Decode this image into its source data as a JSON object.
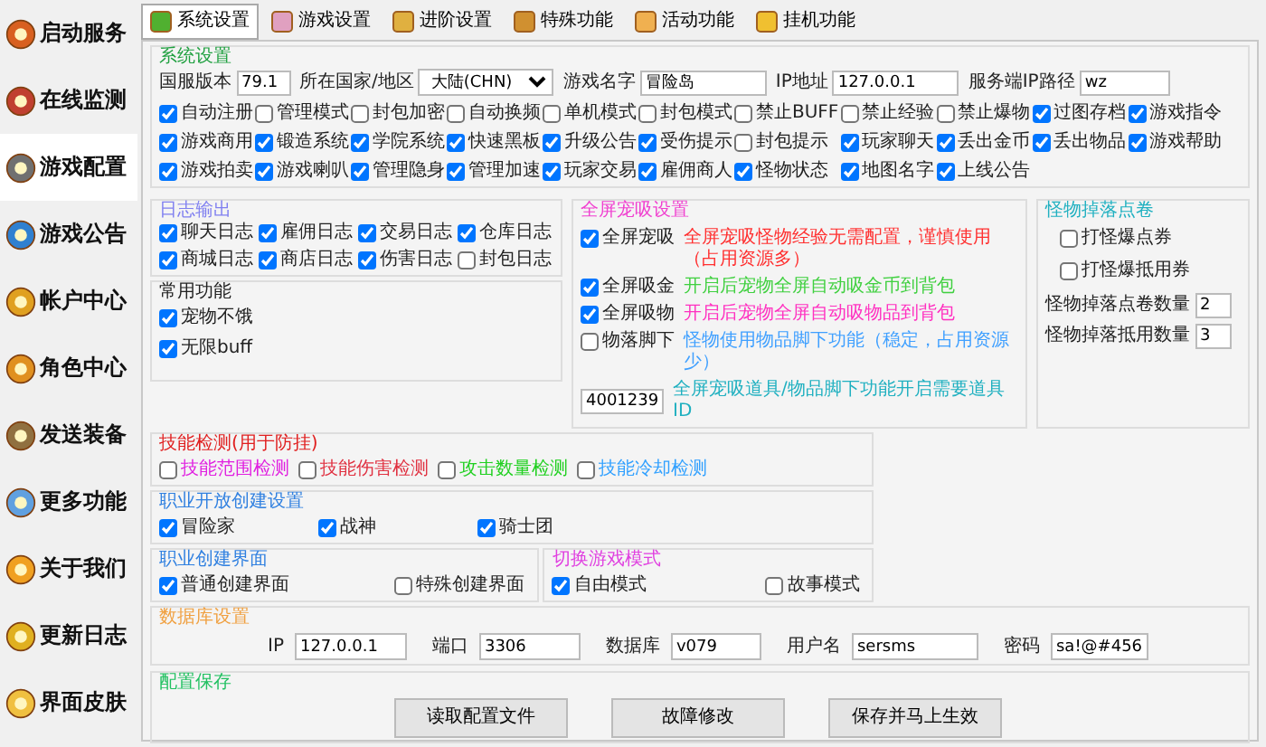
{
  "sidebar": {
    "items": [
      {
        "label": "启动服务",
        "selected": false
      },
      {
        "label": "在线监测",
        "selected": false
      },
      {
        "label": "游戏配置",
        "selected": true
      },
      {
        "label": "游戏公告",
        "selected": false
      },
      {
        "label": "帐户中心",
        "selected": false
      },
      {
        "label": "角色中心",
        "selected": false
      },
      {
        "label": "发送装备",
        "selected": false
      },
      {
        "label": "更多功能",
        "selected": false
      },
      {
        "label": "关于我们",
        "selected": false
      },
      {
        "label": "更新日志",
        "selected": false
      },
      {
        "label": "界面皮肤",
        "selected": false
      }
    ]
  },
  "tabs": [
    {
      "label": "系统设置",
      "selected": true
    },
    {
      "label": "游戏设置",
      "selected": false
    },
    {
      "label": "进阶设置",
      "selected": false
    },
    {
      "label": "特殊功能",
      "selected": false
    },
    {
      "label": "活动功能",
      "selected": false
    },
    {
      "label": "挂机功能",
      "selected": false
    }
  ],
  "system_settings": {
    "title": "系统设置",
    "fields": [
      {
        "label": "国服版本",
        "value": "79.1",
        "kind": "text"
      },
      {
        "label": "所在国家/地区",
        "value": "大陆(CHN)",
        "kind": "select"
      },
      {
        "label": "游戏名字",
        "value": "冒险岛",
        "kind": "text"
      },
      {
        "label": "IP地址",
        "value": "127.0.0.1",
        "kind": "text"
      },
      {
        "label": "服务端IP路径",
        "value": "wz",
        "kind": "text"
      }
    ],
    "checkbox_rows": [
      [
        {
          "label": "自动注册",
          "checked": true
        },
        {
          "label": "管理模式",
          "checked": false
        },
        {
          "label": "封包加密",
          "checked": false
        },
        {
          "label": "自动换频",
          "checked": false
        },
        {
          "label": "单机模式",
          "checked": false
        },
        {
          "label": "封包模式",
          "checked": false
        },
        {
          "label": "禁止BUFF",
          "checked": false
        },
        {
          "label": "禁止经验",
          "checked": false
        },
        {
          "label": "禁止爆物",
          "checked": false
        },
        {
          "label": "过图存档",
          "checked": true
        },
        {
          "label": "游戏指令",
          "checked": true
        }
      ],
      [
        {
          "label": "游戏商用",
          "checked": true
        },
        {
          "label": "锻造系统",
          "checked": true
        },
        {
          "label": "学院系统",
          "checked": true
        },
        {
          "label": "快速黑板",
          "checked": true
        },
        {
          "label": "升级公告",
          "checked": true
        },
        {
          "label": "受伤提示",
          "checked": true
        },
        {
          "label": "封包提示",
          "checked": false
        },
        {
          "label": "玩家聊天",
          "checked": true
        },
        {
          "label": "丢出金币",
          "checked": true
        },
        {
          "label": "丢出物品",
          "checked": true
        },
        {
          "label": "游戏帮助",
          "checked": true
        }
      ],
      [
        {
          "label": "游戏拍卖",
          "checked": true
        },
        {
          "label": "游戏喇叭",
          "checked": true
        },
        {
          "label": "管理隐身",
          "checked": true
        },
        {
          "label": "管理加速",
          "checked": true
        },
        {
          "label": "玩家交易",
          "checked": true
        },
        {
          "label": "雇佣商人",
          "checked": true
        },
        {
          "label": "怪物状态",
          "checked": true
        },
        {
          "label": "地图名字",
          "checked": true
        },
        {
          "label": "上线公告",
          "checked": true
        }
      ]
    ]
  },
  "log_output": {
    "title": "日志输出",
    "checkboxes": [
      {
        "label": "聊天日志",
        "checked": true
      },
      {
        "label": "雇佣日志",
        "checked": true
      },
      {
        "label": "交易日志",
        "checked": true
      },
      {
        "label": "仓库日志",
        "checked": true
      },
      {
        "label": "商城日志",
        "checked": true
      },
      {
        "label": "商店日志",
        "checked": true
      },
      {
        "label": "伤害日志",
        "checked": true
      },
      {
        "label": "封包日志",
        "checked": false
      }
    ]
  },
  "common_functions": {
    "title": "常用功能",
    "checkboxes": [
      {
        "label": "宠物不饿",
        "checked": true
      },
      {
        "label": "无限buff",
        "checked": true
      }
    ]
  },
  "pet_vacuum": {
    "title": "全屏宠吸设置",
    "options": [
      {
        "label": "全屏宠吸",
        "checked": true,
        "note": "全屏宠吸怪物经验无需配置，谨慎使用（占用资源多）",
        "color": "#ff3030"
      },
      {
        "label": "全屏吸金",
        "checked": true,
        "note": "开启后宠物全屏自动吸金币到背包",
        "color": "#40d040"
      },
      {
        "label": "全屏吸物",
        "checked": true,
        "note": "开启后宠物全屏自动吸物品到背包",
        "color": "#ff30c0"
      },
      {
        "label": "物落脚下",
        "checked": false,
        "note": "怪物使用物品脚下功能（稳定，占用资源少）",
        "color": "#40a0ff"
      }
    ],
    "id_field": {
      "value": "4001239",
      "note": "全屏宠吸道具/物品脚下功能开启需要道具ID"
    }
  },
  "monster_drop": {
    "title": "怪物掉落点卷",
    "checkboxes": [
      {
        "label": "打怪爆点券",
        "checked": false
      },
      {
        "label": "打怪爆抵用券",
        "checked": false
      }
    ],
    "fields": [
      {
        "label": "怪物掉落点卷数量",
        "value": "2"
      },
      {
        "label": "怪物掉落抵用数量",
        "value": "3"
      }
    ]
  },
  "skill_check": {
    "title": "技能检测(用于防挂)",
    "checkboxes": [
      {
        "label": "技能范围检测",
        "checked": false,
        "color": "#e020e0"
      },
      {
        "label": "技能伤害检测",
        "checked": false,
        "color": "#e03040"
      },
      {
        "label": "攻击数量检测",
        "checked": false,
        "color": "#20d020"
      },
      {
        "label": "技能冷却检测",
        "checked": false,
        "color": "#30a0ff"
      }
    ]
  },
  "job_open": {
    "title": "职业开放创建设置",
    "checkboxes": [
      {
        "label": "冒险家",
        "checked": true
      },
      {
        "label": "战神",
        "checked": true
      },
      {
        "label": "骑士团",
        "checked": true
      }
    ]
  },
  "create_ui": {
    "title": "职业创建界面",
    "checkboxes": [
      {
        "label": "普通创建界面",
        "checked": true
      },
      {
        "label": "特殊创建界面",
        "checked": false
      }
    ]
  },
  "game_mode": {
    "title": "切换游戏模式",
    "checkboxes": [
      {
        "label": "自由模式",
        "checked": true
      },
      {
        "label": "故事模式",
        "checked": false
      }
    ]
  },
  "database": {
    "title": "数据库设置",
    "fields": [
      {
        "label": "IP",
        "value": "127.0.0.1"
      },
      {
        "label": "端口",
        "value": "3306"
      },
      {
        "label": "数据库",
        "value": "v079"
      },
      {
        "label": "用户名",
        "value": "sersms"
      },
      {
        "label": "密码",
        "value": "sa!@#456"
      }
    ]
  },
  "save": {
    "title": "配置保存",
    "buttons": [
      "读取配置文件",
      "故障修改",
      "保存并马上生效"
    ]
  }
}
